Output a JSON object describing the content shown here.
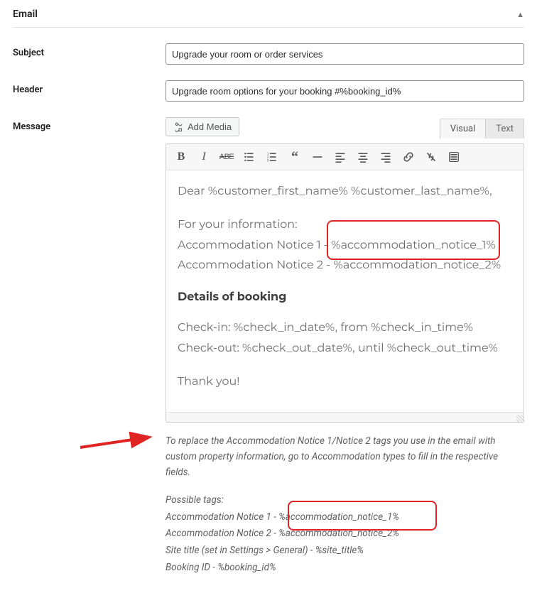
{
  "section": {
    "title": "Email"
  },
  "fields": {
    "subject": {
      "label": "Subject",
      "value": "Upgrade your room or order services"
    },
    "header": {
      "label": "Header",
      "value": "Upgrade room options for your booking #%booking_id%"
    },
    "message": {
      "label": "Message"
    }
  },
  "toolbar": {
    "add_media": "Add Media",
    "tabs": {
      "visual": "Visual",
      "text": "Text"
    }
  },
  "editor": {
    "greeting": "Dear %customer_first_name% %customer_last_name%,",
    "fyi": "For your information:",
    "notice1_label": "Accommodation Notice 1 - ",
    "notice1_tag": "%accommodation_notice_1%",
    "notice2_label": "Accommodation Notice 2 - ",
    "notice2_tag": "%accommodation_notice_2%",
    "details_heading": "Details of booking",
    "checkin": "Check-in: %check_in_date%, from %check_in_time%",
    "checkout": "Check-out: %check_out_date%, until %check_out_time%",
    "thanks": "Thank you!"
  },
  "help": {
    "replace_info": "To replace the Accommodation Notice 1/Notice 2 tags you use in the email with custom property information, go to Accommodation types to fill in the respective fields.",
    "possible_tags_label": "Possible tags:",
    "tag1_label": "Accommodation Notice 1 - ",
    "tag1_value": "%accommodation_notice_1%",
    "tag2_label": "Accommodation Notice 2 - ",
    "tag2_value": "%accommodation_notice_2%",
    "tag3": "Site title (set in Settings > General) - %site_title%",
    "tag4": "Booking ID - %booking_id%"
  }
}
